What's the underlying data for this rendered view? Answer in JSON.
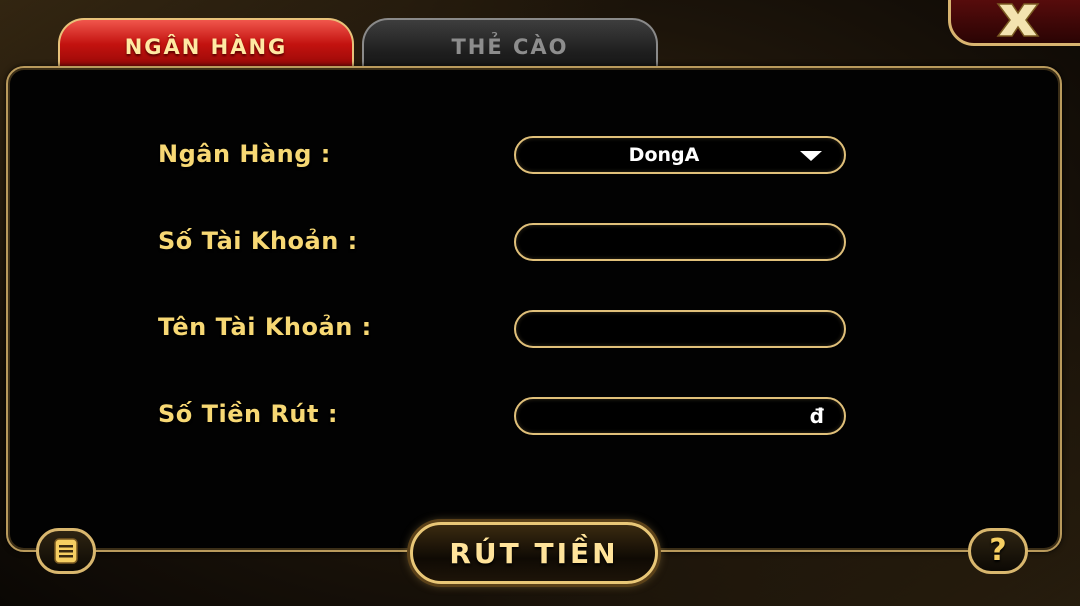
{
  "tabs": {
    "bank_label": "NGÂN HÀNG",
    "card_label": "THẺ CÀO"
  },
  "form": {
    "bank_label": "Ngân Hàng :",
    "bank_selected": "DongA",
    "account_number_label": "Số Tài Khoản :",
    "account_number_value": "",
    "account_name_label": "Tên Tài Khoản :",
    "account_name_value": "",
    "amount_label": "Số Tiền Rút :",
    "amount_value": "",
    "currency_symbol": "đ"
  },
  "actions": {
    "withdraw_label": "RÚT TIỀN",
    "help_glyph": "?"
  },
  "icons": {
    "close": "close-icon",
    "caret": "chevron-down-icon",
    "history": "history-list-icon",
    "help": "help-icon"
  },
  "colors": {
    "accent_gold": "#f7d874",
    "active_tab_red": "#c3120f",
    "border_gold": "#e0c07a",
    "panel_black": "#020202"
  }
}
